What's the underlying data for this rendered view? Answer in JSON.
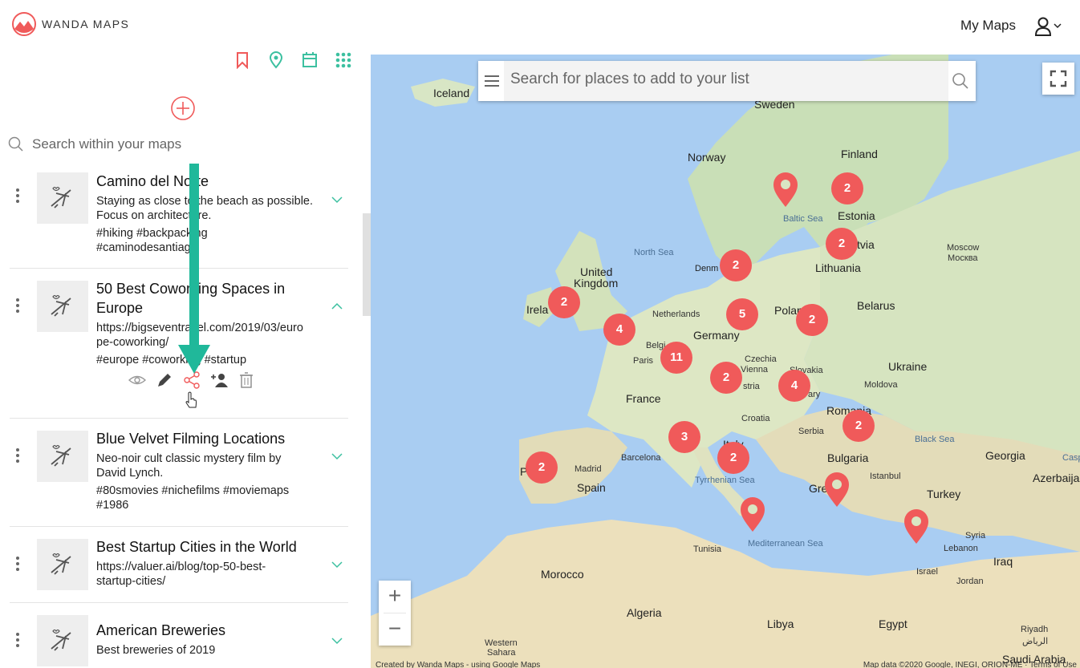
{
  "app": {
    "logo_text": "WANDA MAPS"
  },
  "header": {
    "my_maps_label": "My Maps"
  },
  "sidebar": {
    "search_placeholder": "Search within your maps",
    "maps": [
      {
        "title": "Camino del Norte",
        "desc1": "Staying as close to the beach as possible.",
        "desc2": "Focus on architecture.",
        "tags1": "#hiking #backpacking",
        "tags2": "#caminodesantiago"
      },
      {
        "title1": "50 Best Coworking Spaces in",
        "title2": "Europe",
        "url1": "https://bigseventravel.com/2019/03/euro",
        "url2": "pe-coworking/",
        "tags": "#europe #coworking #startup"
      },
      {
        "title": "Blue Velvet Filming Locations",
        "desc1": "Neo-noir cult classic mystery film by",
        "desc2": "David Lynch.",
        "tags1": "#80smovies #nichefilms #moviemaps",
        "tags2": "#1986"
      },
      {
        "title": "Best Startup Cities in the World",
        "url1": "https://valuer.ai/blog/top-50-best-",
        "url2": "startup-cities/"
      },
      {
        "title": "American Breweries",
        "desc1": "Best breweries of 2019"
      }
    ]
  },
  "map": {
    "search_placeholder": "Search for places to add to your list",
    "zoom_in": "+",
    "zoom_out": "−",
    "credit_left": "Created by Wanda Maps - using Google Maps",
    "credit_right": "Map data ©2020 Google, INEGI, ORION-ME · Terms of Use",
    "clusters": [
      "2",
      "2",
      "2",
      "2",
      "4",
      "5",
      "2",
      "11",
      "2",
      "4",
      "3",
      "2",
      "2",
      "2"
    ],
    "labels": {
      "iceland": "Iceland",
      "sweden": "Sweden",
      "norway": "Norway",
      "finland": "Finland",
      "estonia": "Estonia",
      "latvia": "tvia",
      "lithuania": "Lithuania",
      "denmark": "Denm",
      "uk1": "United",
      "uk2": "Kingdom",
      "ireland": "Irela",
      "netherlands": "Netherlands",
      "germany": "Germany",
      "poland": "Polan",
      "belarus": "Belarus",
      "belgium": "Belgi",
      "paris": "Paris",
      "czechia": "Czechia",
      "vienna": "Vienna",
      "slovakia": "Slovakia",
      "austria": "stria",
      "hungary": "ary",
      "ukraine": "Ukraine",
      "moldova": "Moldova",
      "france": "France",
      "croatia": "Croatia",
      "serbia": "Serbia",
      "romania": "Romania",
      "italy": "Italy",
      "bulgaria": "Bulgaria",
      "barcelona": "Barcelona",
      "madrid": "Madrid",
      "spain": "Spain",
      "portugal": "P",
      "tyrrhenian": "Tyrrhenian Sea",
      "greece": "Gre",
      "istanbul": "Istanbul",
      "turkey": "Turkey",
      "georgia": "Georgia",
      "azerbaijan": "Azerbaija",
      "caspian": "Casp",
      "tunisia": "Tunisia",
      "med": "Mediterranean Sea",
      "syria": "Syria",
      "lebanon": "Lebanon",
      "iraq": "Iraq",
      "israel": "Israel",
      "jordan": "Jordan",
      "morocco": "Morocco",
      "algeria": "Algeria",
      "libya": "Libya",
      "egypt": "Egypt",
      "saudi": "Saudi Arabia",
      "riyadh": "Riyadh",
      "riyadh_ar": "الرياض",
      "western_sahara1": "Western",
      "western_sahara2": "Sahara",
      "moscow": "Moscow",
      "moscow_ru": "Москва",
      "north_sea": "North Sea",
      "baltic": "Baltic Sea",
      "black_sea": "Black Sea"
    }
  },
  "colors": {
    "accent_red": "#f05a5a",
    "accent_green": "#3cc0a0",
    "arrow_teal": "#20b89a"
  }
}
